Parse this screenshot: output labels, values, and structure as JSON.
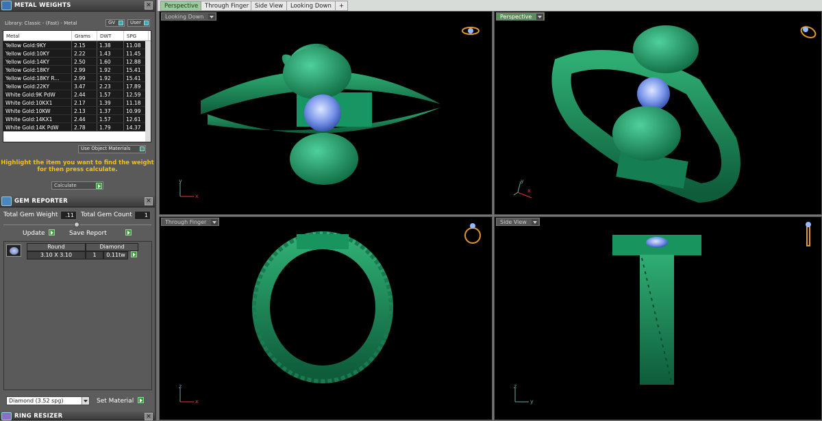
{
  "metal_weights": {
    "title": "METAL WEIGHTS",
    "library": "Library: Classic - (Fast) - Metal",
    "gv": "GV",
    "user": "User",
    "columns": [
      "Metal",
      "Grams",
      "DWT",
      "SPG"
    ],
    "rows": [
      [
        "Yellow Gold:9KY",
        "2.15",
        "1.38",
        "11.08"
      ],
      [
        "Yellow Gold:10KY",
        "2.22",
        "1.43",
        "11.45"
      ],
      [
        "Yellow Gold:14KY",
        "2.50",
        "1.60",
        "12.88"
      ],
      [
        "Yellow Gold:18KY",
        "2.99",
        "1.92",
        "15.41"
      ],
      [
        "Yellow Gold:18KY R...",
        "2.99",
        "1.92",
        "15.41"
      ],
      [
        "Yellow Gold:22KY",
        "3.47",
        "2.23",
        "17.89"
      ],
      [
        "White Gold:9K PdW",
        "2.44",
        "1.57",
        "12.59"
      ],
      [
        "White Gold:10KX1",
        "2.17",
        "1.39",
        "11.18"
      ],
      [
        "White Gold:10KW",
        "2.13",
        "1.37",
        "10.99"
      ],
      [
        "White Gold:14KX1",
        "2.44",
        "1.57",
        "12.61"
      ],
      [
        "White Gold:14K PdW",
        "2.78",
        "1.79",
        "14.37"
      ]
    ],
    "use_object_materials": "Use Object Materials",
    "hint": "Highlight the item you want to find the weight for then press calculate.",
    "calculate": "Calculate"
  },
  "gem_reporter": {
    "title": "GEM REPORTER",
    "total_weight_label": "Total Gem Weight",
    "total_weight": ".11",
    "total_count_label": "Total Gem Count",
    "total_count": "1",
    "update": "Update",
    "save_report": "Save Report",
    "gem": {
      "shape": "Round",
      "size": "3.10 X 3.10",
      "type": "Diamond",
      "count": "1",
      "weight": "0.11tw"
    },
    "material": "Diamond   (3.52 spg)",
    "set_material": "Set Material"
  },
  "ring_resizer": {
    "title": "RING RESIZER"
  },
  "tabs": [
    "Perspective",
    "Through Finger",
    "Side View",
    "Looking Down",
    "+"
  ],
  "viewports": {
    "top_left": "Looking Down",
    "top_right": "Perspective",
    "bottom_left": "Through Finger",
    "bottom_right": "Side View"
  },
  "axes": {
    "x": "x",
    "y": "y",
    "z": "z"
  },
  "colors": {
    "ring": "#1f8a5a",
    "gem": "#6f8fe6",
    "background": "#000000",
    "accent": "#f4c20d"
  }
}
